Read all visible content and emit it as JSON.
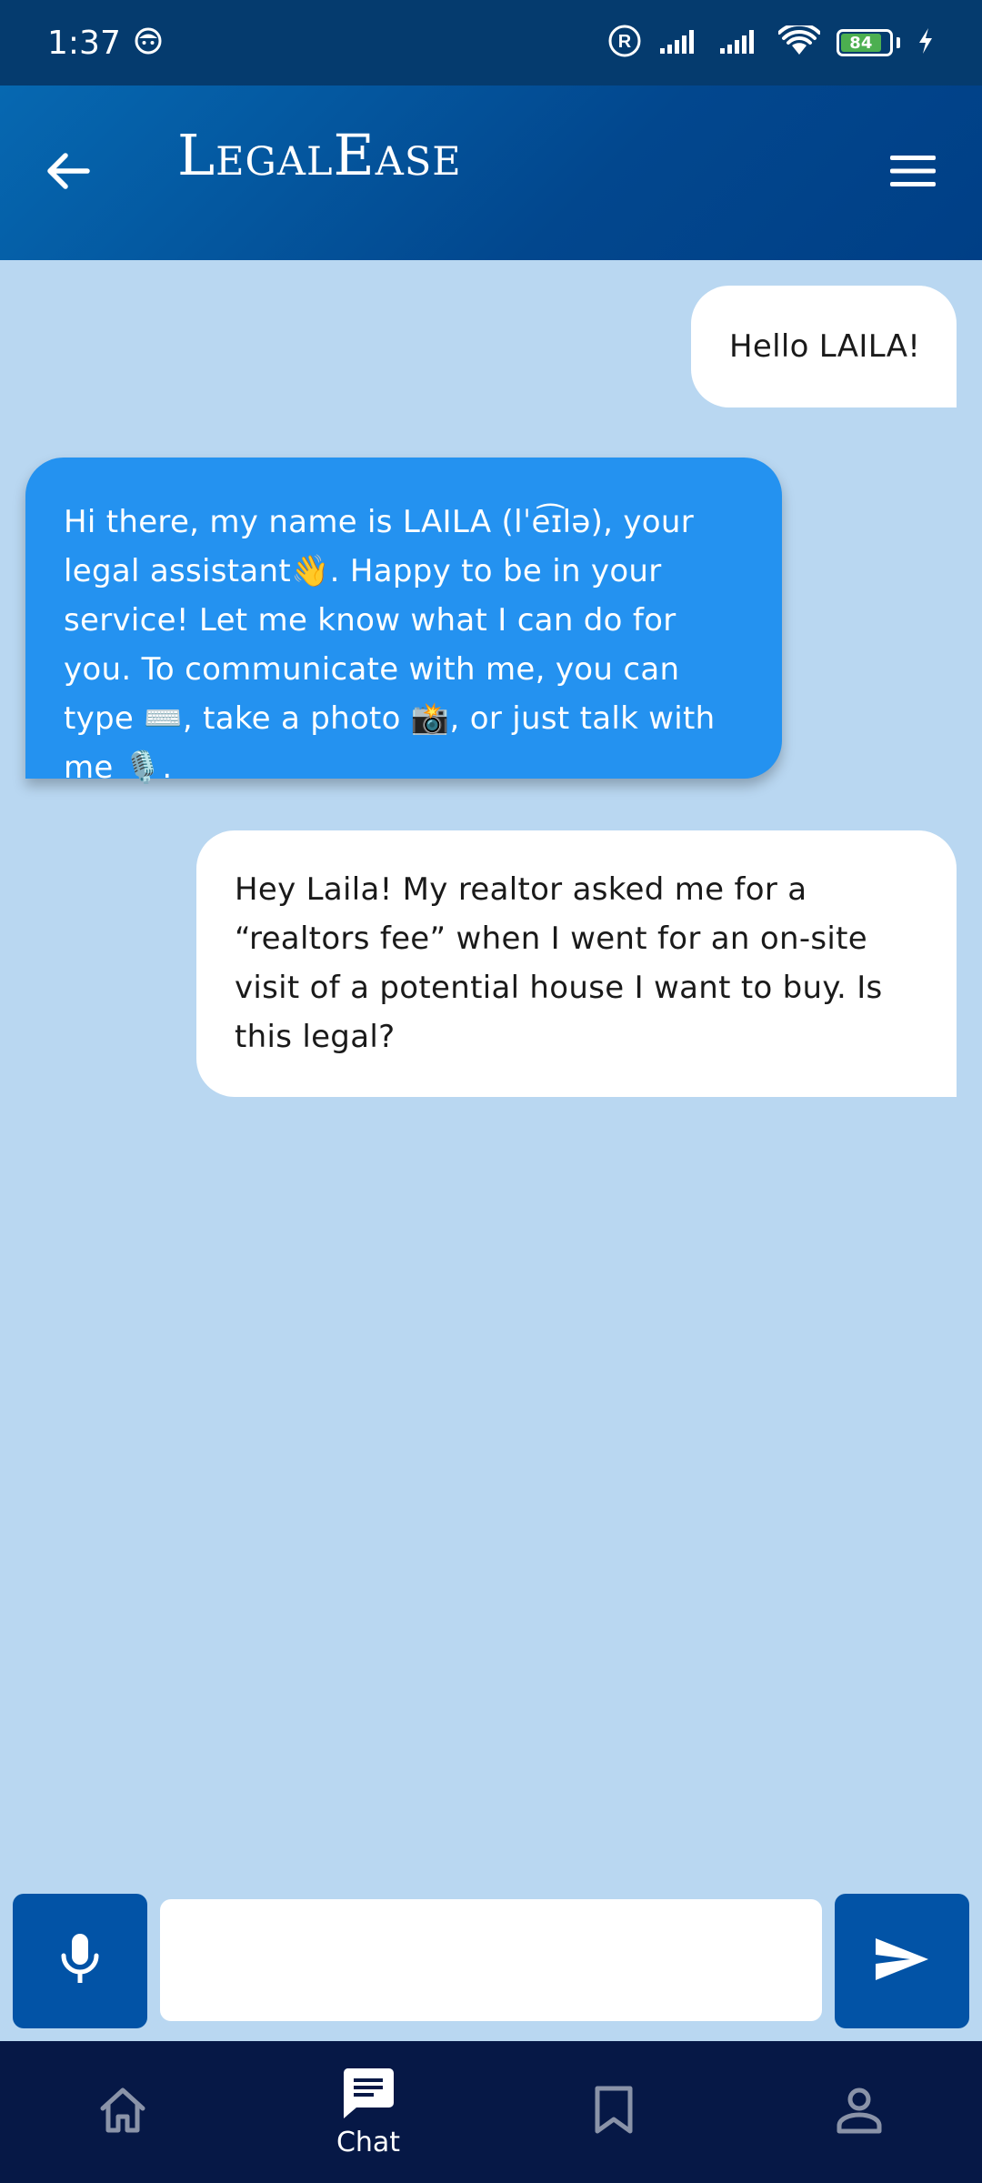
{
  "status_bar": {
    "time": "1:37",
    "battery": "84",
    "icons": [
      "face-icon",
      "registered-icon",
      "signal-icon",
      "signal-icon",
      "wifi-icon",
      "battery-icon",
      "charging-icon"
    ]
  },
  "app_bar": {
    "title": "LegalEase",
    "back_icon": "arrow-left-icon",
    "menu_icon": "menu-icon"
  },
  "messages": [
    {
      "sender": "user",
      "text": "Hello LAILA!"
    },
    {
      "sender": "bot",
      "text": "Hi there, my name is LAILA (lˈe͡ɪlə), your legal assistant👋. Happy to be in your service! Let me know what I can do for you. To communicate with me, you can type ⌨️, take a photo 📸, or just talk with me 🎙️."
    },
    {
      "sender": "user",
      "text": "Hey Laila! My realtor asked me for a “realtors fee” when I went for an on-site visit of a potential house I want to buy. Is this legal?"
    }
  ],
  "composer": {
    "value": "",
    "placeholder": "",
    "mic_icon": "microphone-icon",
    "send_icon": "send-icon"
  },
  "bottom_nav": {
    "items": [
      {
        "icon": "home-icon",
        "label": ""
      },
      {
        "icon": "chat-icon",
        "label": "Chat"
      },
      {
        "icon": "bookmark-icon",
        "label": ""
      },
      {
        "icon": "profile-icon",
        "label": ""
      }
    ],
    "active_index": 1
  },
  "colors": {
    "app_bar": "#02478e",
    "chat_background": "#b9d7f1",
    "bot_bubble": "#2492f0",
    "user_bubble": "#ffffff",
    "action_button": "#0253a6",
    "nav_background": "#061846",
    "nav_active": "#ffffff",
    "nav_inactive": "#8a93a8"
  }
}
